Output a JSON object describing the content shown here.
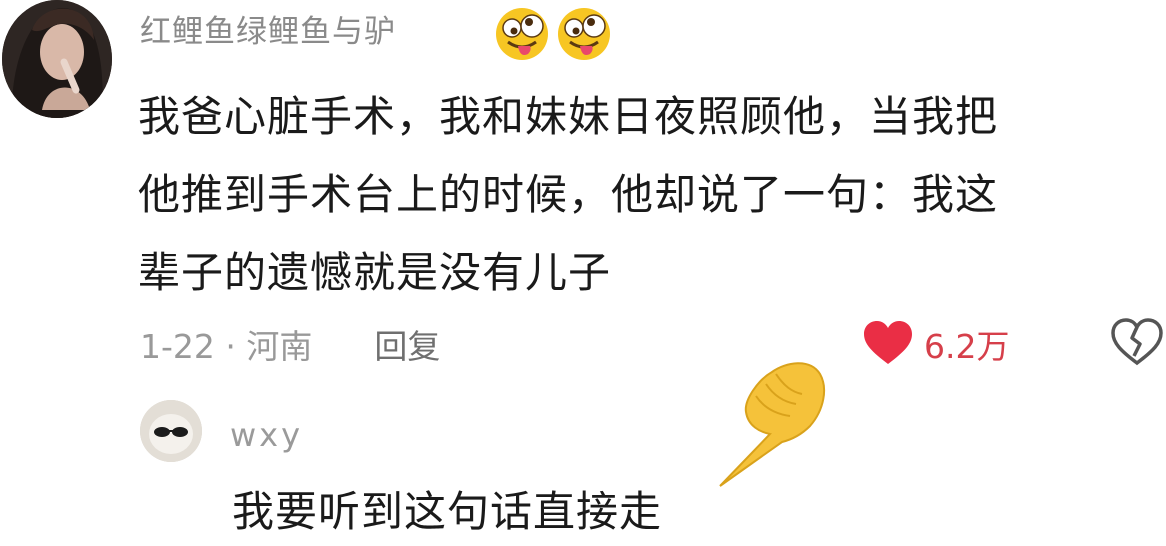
{
  "comment": {
    "username": "红鲤鱼绿鲤鱼与驴",
    "username_emojis": [
      "crazy-face-emoji",
      "crazy-face-emoji"
    ],
    "text_lines": [
      "我爸心脏手术，我和妹妹日夜照顾他，当我把",
      "他推到手术台上的时候，他却说了一句：我这",
      "辈子的遗憾就是没有儿子"
    ],
    "date_location": "1-22 · 河南",
    "reply_label": "回复",
    "like_count": "6.2万"
  },
  "reply": {
    "username": "wxy",
    "text": "我要听到这句话直接走"
  },
  "colors": {
    "like_red": "#d63f4a",
    "meta_gray": "#999999",
    "text_dark": "#1a1a1a"
  }
}
